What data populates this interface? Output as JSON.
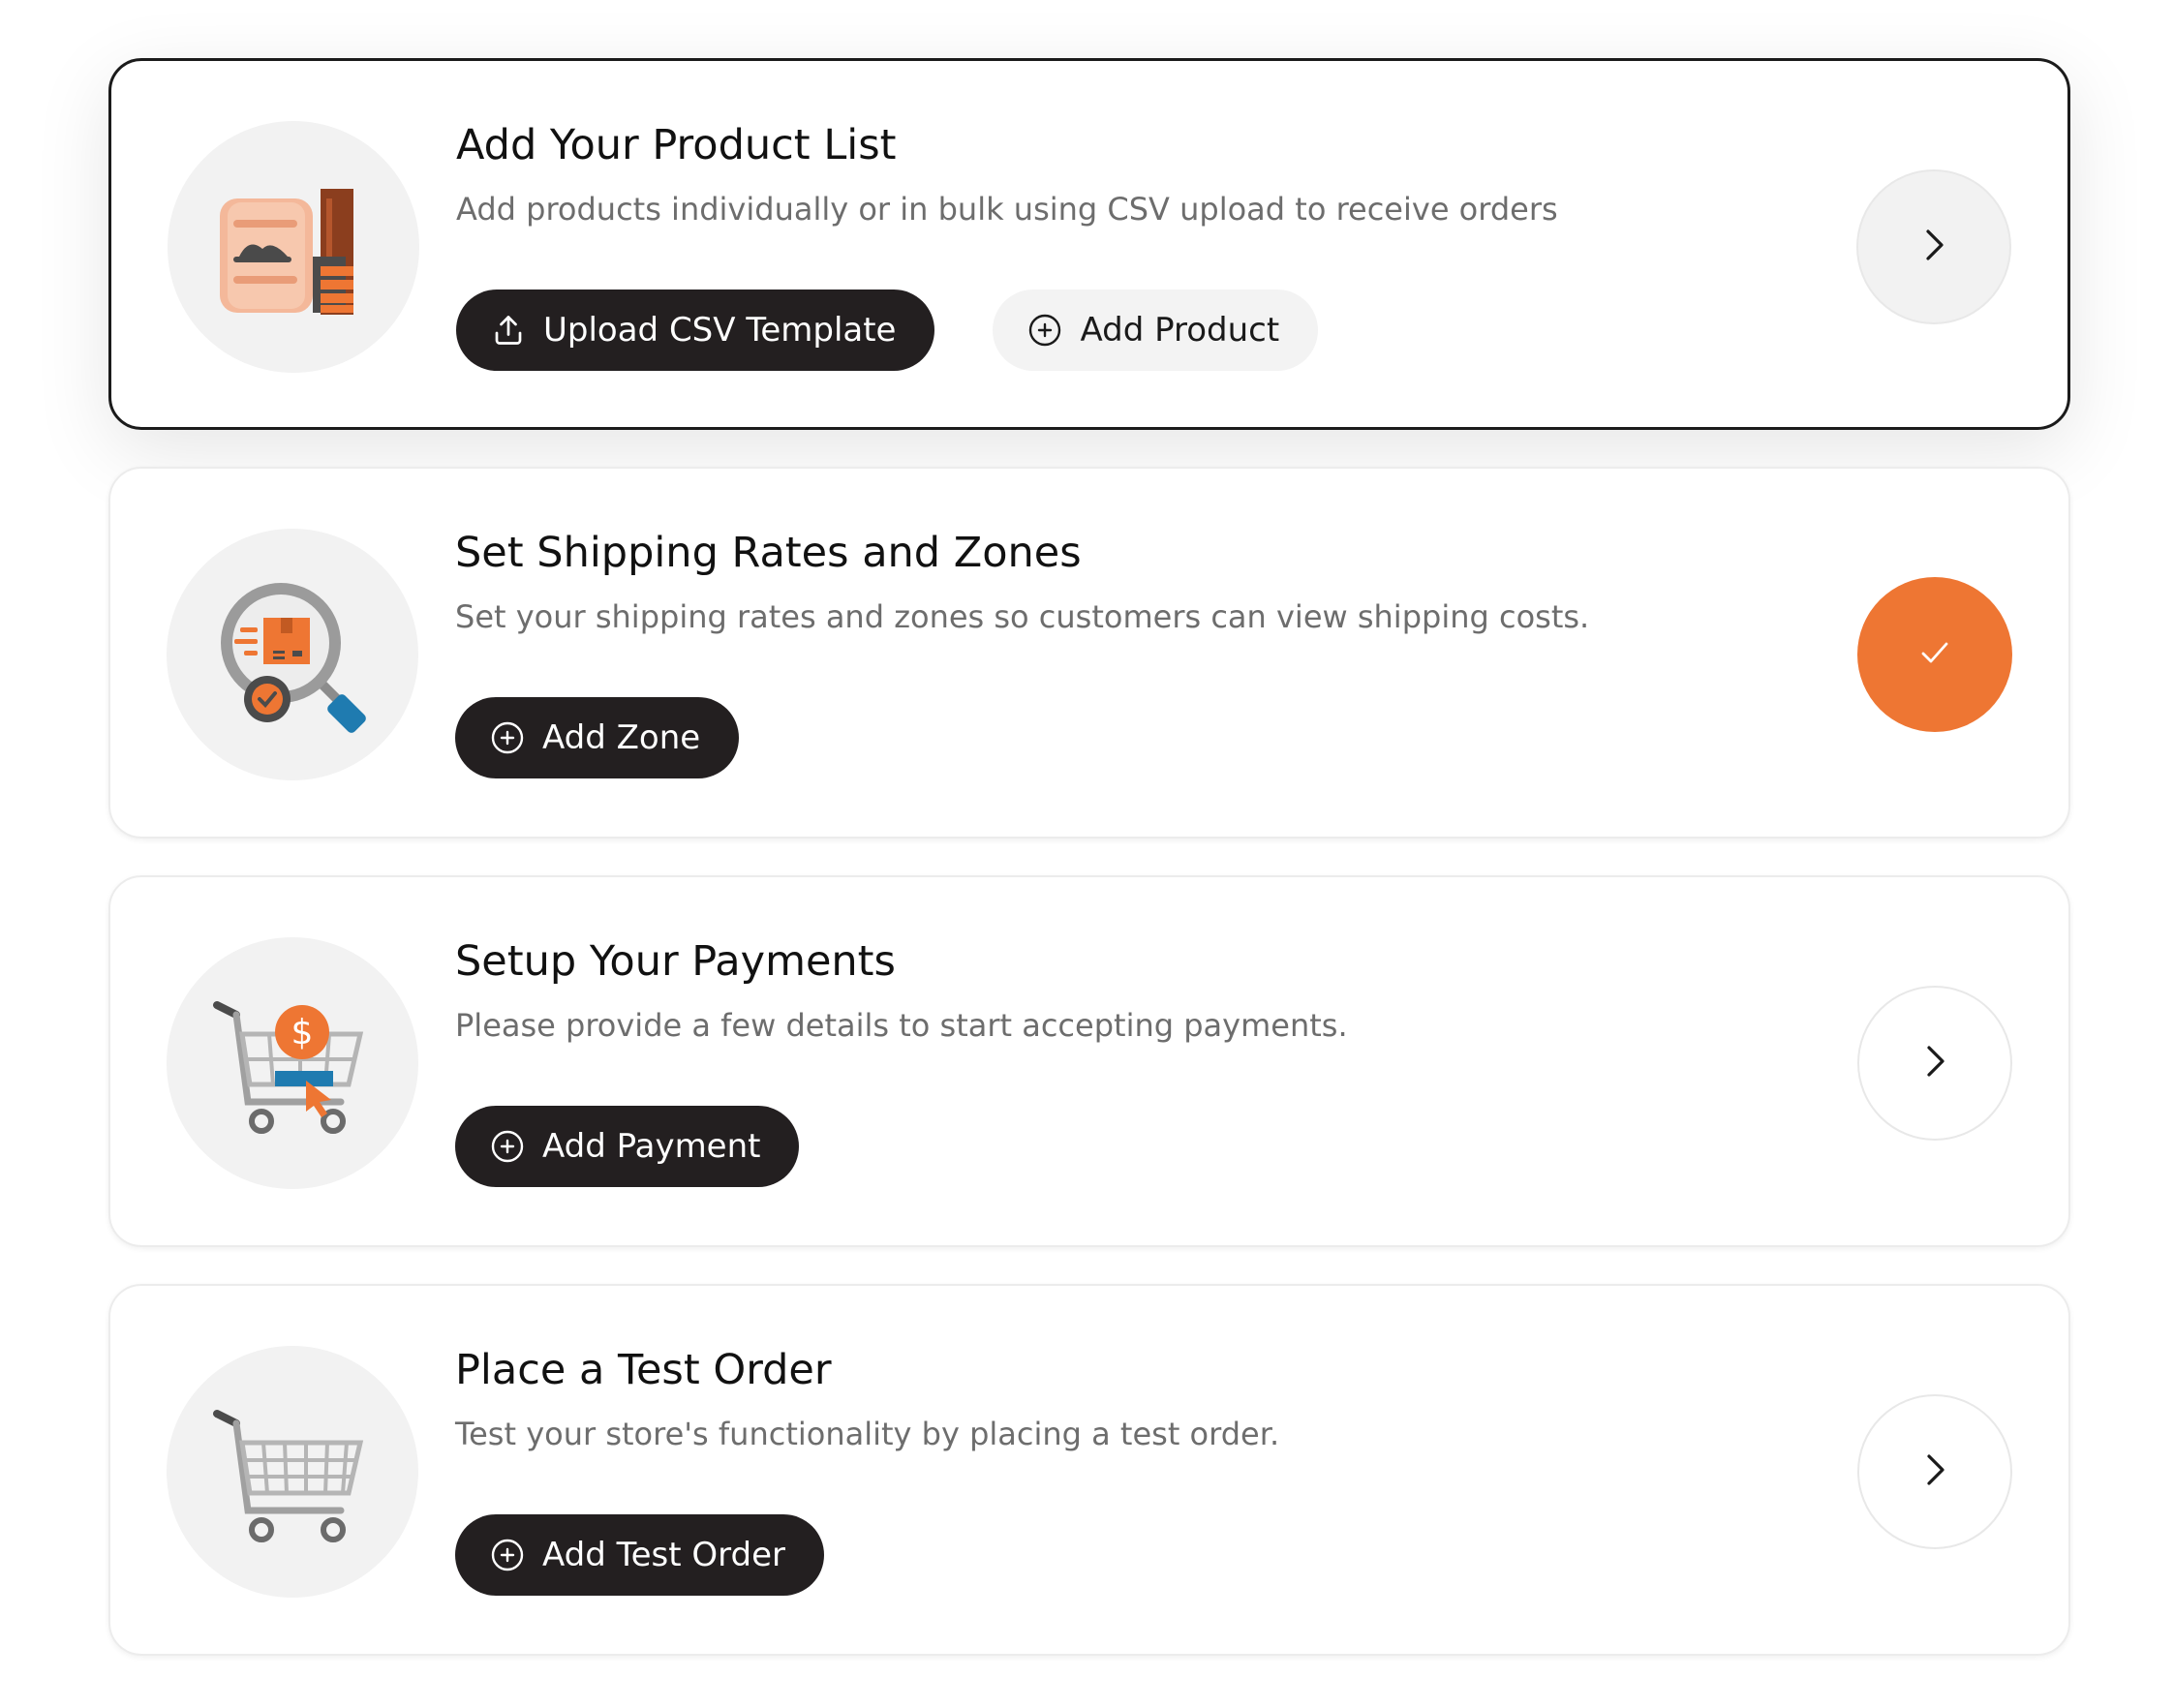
{
  "colors": {
    "accent": "#ee7633",
    "button_dark": "#231f20",
    "card_border_active": "#1b1b1b"
  },
  "steps": [
    {
      "title": "Add Your Product List",
      "description": "Add products individually or in bulk using CSV upload to receive orders",
      "illustration": "product-sacks-icon",
      "status": "active",
      "buttons": [
        {
          "label": "Upload CSV Template",
          "icon": "upload-icon",
          "style": "dark"
        },
        {
          "label": "Add Product",
          "icon": "plus-circle-icon",
          "style": "light"
        }
      ],
      "action_icon": "chevron-right-icon"
    },
    {
      "title": "Set Shipping Rates and Zones",
      "description": "Set your shipping rates and zones so customers can view shipping costs.",
      "illustration": "shipping-magnifier-icon",
      "status": "completed",
      "buttons": [
        {
          "label": "Add Zone",
          "icon": "plus-circle-icon",
          "style": "dark"
        }
      ],
      "action_icon": "checkmark-icon"
    },
    {
      "title": "Setup Your Payments",
      "description": "Please provide a few details to start accepting payments.",
      "illustration": "payment-cart-icon",
      "status": "pending",
      "buttons": [
        {
          "label": "Add Payment",
          "icon": "plus-circle-icon",
          "style": "dark"
        }
      ],
      "action_icon": "chevron-right-icon"
    },
    {
      "title": "Place a Test Order",
      "description": "Test your store's functionality by placing a test order.",
      "illustration": "shopping-cart-icon",
      "status": "pending",
      "buttons": [
        {
          "label": "Add Test Order",
          "icon": "plus-circle-icon",
          "style": "dark"
        }
      ],
      "action_icon": "chevron-right-icon"
    }
  ]
}
